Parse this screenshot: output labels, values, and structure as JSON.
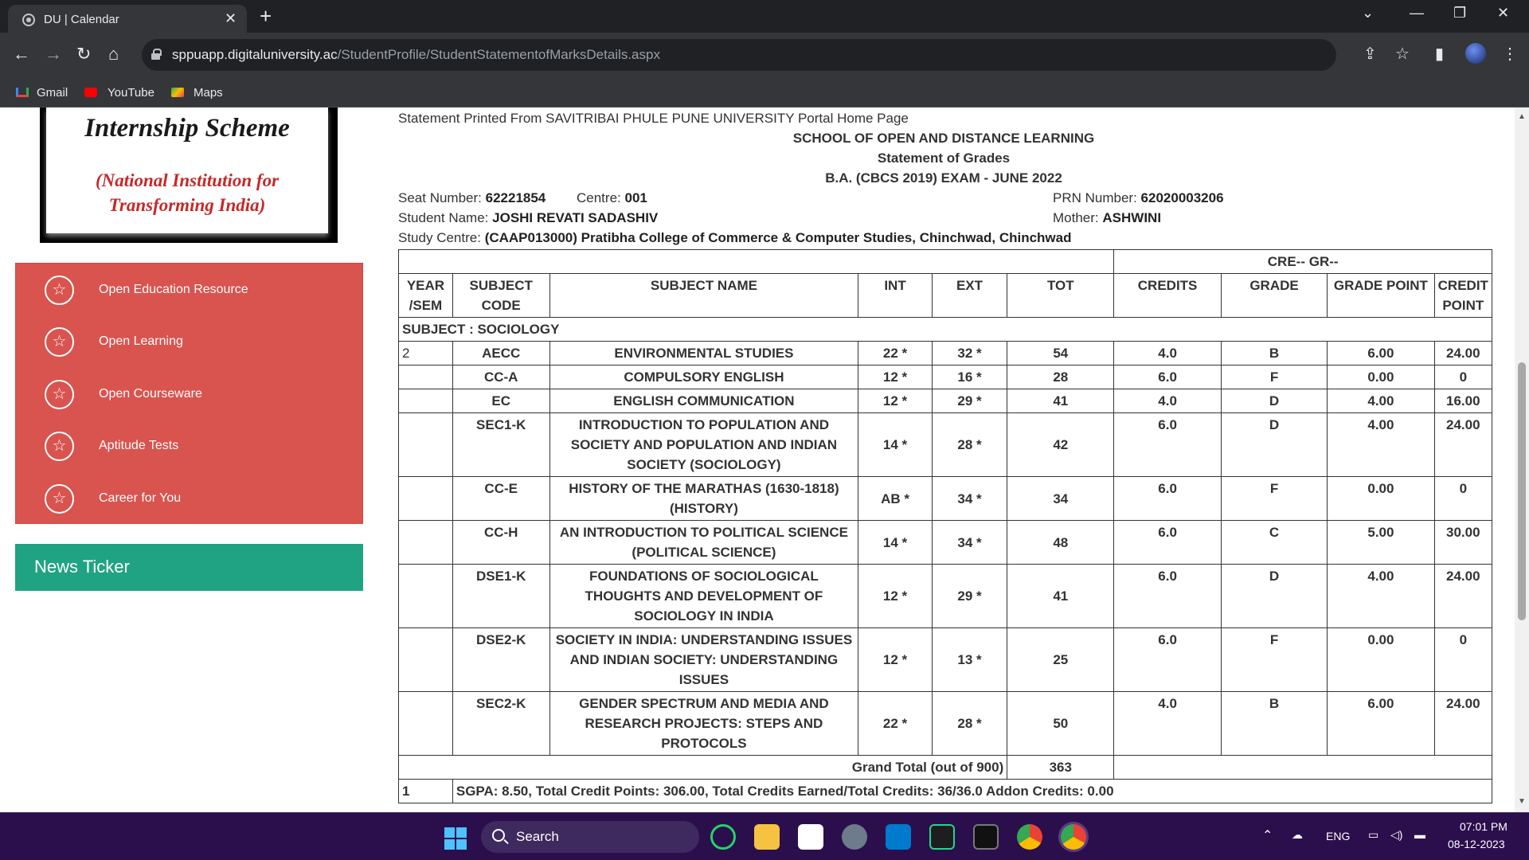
{
  "browser": {
    "tab_title": "DU | Calendar",
    "url_domain": "sppuapp.digitaluniversity.ac",
    "url_path": "/StudentProfile/StudentStatementofMarksDetails.aspx",
    "bookmarks": [
      "Gmail",
      "YouTube",
      "Maps"
    ]
  },
  "sidebar": {
    "banner_title": "Internship Scheme",
    "banner_sub_1": "(National Institution for",
    "banner_sub_2": "Transforming India)",
    "menu": [
      "Open Education Resource",
      "Open Learning",
      "Open Courseware",
      "Aptitude Tests",
      "Career for You"
    ],
    "news_ticker": "News Ticker"
  },
  "statement": {
    "printed_from": "Statement Printed From SAVITRIBAI PHULE PUNE UNIVERSITY  Portal Home Page",
    "school": "SCHOOL OF OPEN AND DISTANCE LEARNING",
    "title": "Statement of Grades",
    "exam": "B.A. (CBCS 2019) EXAM - JUNE 2022",
    "seat_label": "Seat Number:",
    "seat_value": "62221854",
    "centre_label": "Centre:",
    "centre_value": "001",
    "prn_label": "PRN Number:",
    "prn_value": "62020003206",
    "name_label": "Student Name:",
    "name_value": "JOSHI REVATI SADASHIV",
    "mother_label": "Mother:",
    "mother_value": "ASHWINI",
    "centre_study_label": "Study Centre:",
    "centre_study_value": "(CAAP013000) Pratibha College of Commerce & Computer Studies, Chinchwad, Chinchwad"
  },
  "table": {
    "cre_gr": "CRE-- GR--",
    "headers": {
      "year": "YEAR /SEM",
      "code": "SUBJECT CODE",
      "name": "SUBJECT NAME",
      "int": "INT",
      "ext": "EXT",
      "tot": "TOT",
      "credits": "CREDITS",
      "grade": "GRADE",
      "grade_point": "GRADE POINT",
      "credit_point": "CREDIT POINT"
    },
    "subject_heading": "SUBJECT : SOCIOLOGY",
    "rows": [
      {
        "year": "2",
        "code": "AECC",
        "name": "ENVIRONMENTAL STUDIES",
        "int": "22 *",
        "ext": "32 *",
        "tot": "54",
        "credits": "4.0",
        "grade": "B",
        "gp": "6.00",
        "cp": "24.00"
      },
      {
        "year": "",
        "code": "CC-A",
        "name": "COMPULSORY ENGLISH",
        "int": "12 *",
        "ext": "16 *",
        "tot": "28",
        "credits": "6.0",
        "grade": "F",
        "gp": "0.00",
        "cp": "0"
      },
      {
        "year": "",
        "code": "EC",
        "name": "ENGLISH COMMUNICATION",
        "int": "12 *",
        "ext": "29 *",
        "tot": "41",
        "credits": "4.0",
        "grade": "D",
        "gp": "4.00",
        "cp": "16.00"
      },
      {
        "year": "",
        "code": "SEC1-K",
        "name": "INTRODUCTION TO POPULATION AND SOCIETY AND POPULATION AND INDIAN SOCIETY (SOCIOLOGY)",
        "int": "14 *",
        "ext": "28 *",
        "tot": "42",
        "credits": "6.0",
        "grade": "D",
        "gp": "4.00",
        "cp": "24.00"
      },
      {
        "year": "",
        "code": "CC-E",
        "name": "HISTORY OF THE MARATHAS (1630-1818) (HISTORY)",
        "int": "AB *",
        "ext": "34 *",
        "tot": "34",
        "credits": "6.0",
        "grade": "F",
        "gp": "0.00",
        "cp": "0"
      },
      {
        "year": "",
        "code": "CC-H",
        "name": "AN INTRODUCTION TO POLITICAL SCIENCE (POLITICAL SCIENCE)",
        "int": "14 *",
        "ext": "34 *",
        "tot": "48",
        "credits": "6.0",
        "grade": "C",
        "gp": "5.00",
        "cp": "30.00"
      },
      {
        "year": "",
        "code": "DSE1-K",
        "name": "FOUNDATIONS OF SOCIOLOGICAL THOUGHTS AND DEVELOPMENT OF SOCIOLOGY IN INDIA",
        "int": "12 *",
        "ext": "29 *",
        "tot": "41",
        "credits": "6.0",
        "grade": "D",
        "gp": "4.00",
        "cp": "24.00"
      },
      {
        "year": "",
        "code": "DSE2-K",
        "name": "SOCIETY IN INDIA: UNDERSTANDING ISSUES AND INDIAN SOCIETY: UNDERSTANDING ISSUES",
        "int": "12 *",
        "ext": "13 *",
        "tot": "25",
        "credits": "6.0",
        "grade": "F",
        "gp": "0.00",
        "cp": "0"
      },
      {
        "year": "",
        "code": "SEC2-K",
        "name": "GENDER SPECTRUM AND MEDIA AND RESEARCH PROJECTS: STEPS AND PROTOCOLS",
        "int": "22 *",
        "ext": "28 *",
        "tot": "50",
        "credits": "4.0",
        "grade": "B",
        "gp": "6.00",
        "cp": "24.00"
      }
    ],
    "grand_total_label": "Grand Total (out of 900)",
    "grand_total_value": "363",
    "sgpa_year": "1",
    "sgpa_text": "SGPA: 8.50, Total Credit Points: 306.00, Total Credits Earned/Total Credits: 36/36.0 Addon Credits: 0.00"
  },
  "taskbar": {
    "search_label": "Search",
    "lang": "ENG",
    "time": "07:01 PM",
    "date": "08-12-2023"
  },
  "colors": {
    "menu_bg": "#d9534f",
    "news_bg": "#1fa383",
    "taskbar_bg": "#2b0f4d",
    "chrome_dark": "#202124"
  }
}
